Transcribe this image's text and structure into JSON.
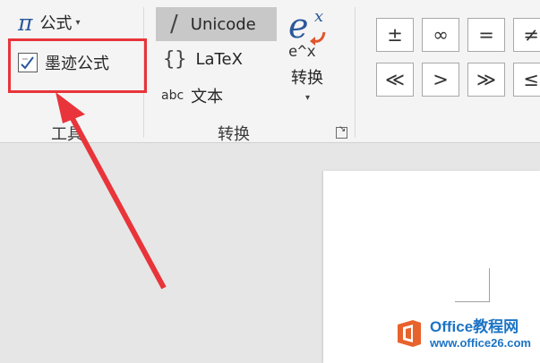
{
  "tools_group": {
    "equation_label": "公式",
    "ink_equation_label": "墨迹公式",
    "group_label": "工具"
  },
  "conversions_group": {
    "unicode_label": "Unicode",
    "latex_label": "LaTeX",
    "text_icon": "abc",
    "text_label": "文本",
    "convert_icon_text": "e^x",
    "convert_label": "转换",
    "group_label": "转换"
  },
  "symbols_group": {
    "row1": [
      "±",
      "∞",
      "=",
      "≠"
    ],
    "row2": [
      "≪",
      ">",
      "≫",
      "≤"
    ]
  },
  "colors": {
    "highlight": "#e8343a",
    "accent": "#2b579a",
    "selected_background": "#c8c8c8",
    "watermark": "#1c74c4"
  },
  "watermark": {
    "title": "Office教程网",
    "url": "www.office26.com"
  }
}
